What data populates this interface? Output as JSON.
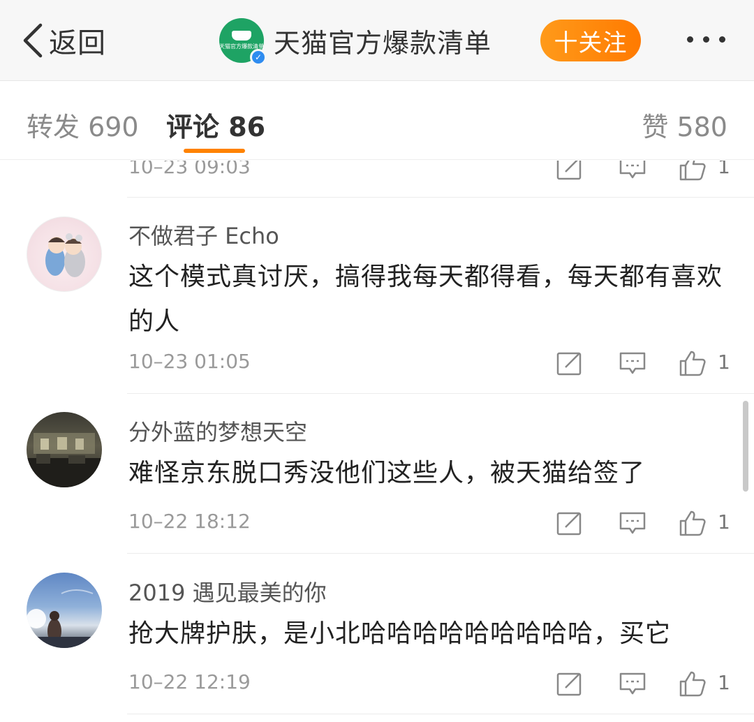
{
  "header": {
    "back_label": "返回",
    "account_name": "天猫官方爆款清单",
    "account_logo_text": "天猫官方爆款清单",
    "follow_label": "十关注",
    "brand_color": "#1ea364",
    "accent_color": "#ff8200"
  },
  "tabs": {
    "repost": "转发 690",
    "comment": "评论 86",
    "like": "赞 580"
  },
  "comments": [
    {
      "name": "",
      "text": "",
      "time": "10–23 09:03",
      "likes": "1"
    },
    {
      "name": "不做君子 Echo",
      "text": "这个模式真讨厌，搞得我每天都得看，每天都有喜欢的人",
      "time": "10–23 01:05",
      "likes": "1"
    },
    {
      "name": "分外蓝的梦想天空",
      "text": "难怪京东脱口秀没他们这些人，被天猫给签了",
      "time": "10–22 18:12",
      "likes": "1"
    },
    {
      "name": "2019 遇见最美的你",
      "text": "抢大牌护肤，是小北哈哈哈哈哈哈哈哈哈，买它",
      "time": "10–22 12:19",
      "likes": "1"
    }
  ],
  "icons": {
    "back": "chevron-left-icon",
    "more": "more-dots-icon",
    "share": "share-icon",
    "reply": "comment-icon",
    "like": "thumbs-up-icon"
  }
}
